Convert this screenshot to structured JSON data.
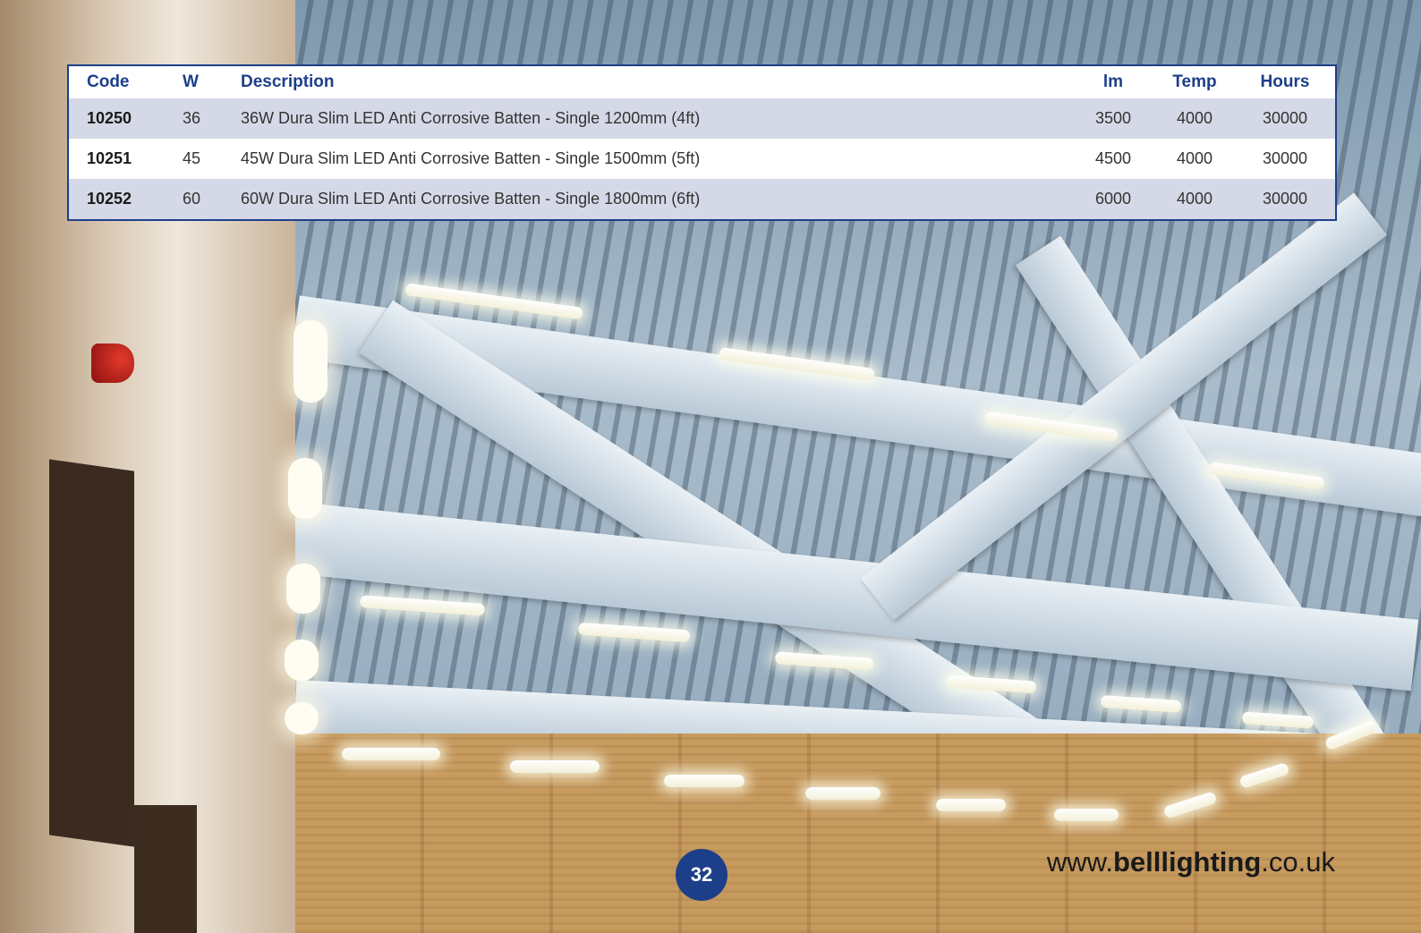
{
  "table": {
    "headers": {
      "code": "Code",
      "w": "W",
      "description": "Description",
      "lm": "lm",
      "temp": "Temp",
      "hours": "Hours"
    },
    "rows": [
      {
        "code": "10250",
        "w": "36",
        "description": "36W Dura Slim LED Anti Corrosive Batten - Single 1200mm (4ft)",
        "lm": "3500",
        "temp": "4000",
        "hours": "30000"
      },
      {
        "code": "10251",
        "w": "45",
        "description": "45W Dura Slim LED Anti Corrosive Batten - Single 1500mm (5ft)",
        "lm": "4500",
        "temp": "4000",
        "hours": "30000"
      },
      {
        "code": "10252",
        "w": "60",
        "description": "60W Dura Slim LED Anti Corrosive Batten - Single 1800mm (6ft)",
        "lm": "6000",
        "temp": "4000",
        "hours": "30000"
      }
    ]
  },
  "footer": {
    "page_number": "32",
    "website_prefix": "www.",
    "website_brand": "belllighting",
    "website_suffix": ".co.uk"
  },
  "colors": {
    "brand_blue": "#1d3f8a",
    "row_alt": "#d5d9e7"
  }
}
